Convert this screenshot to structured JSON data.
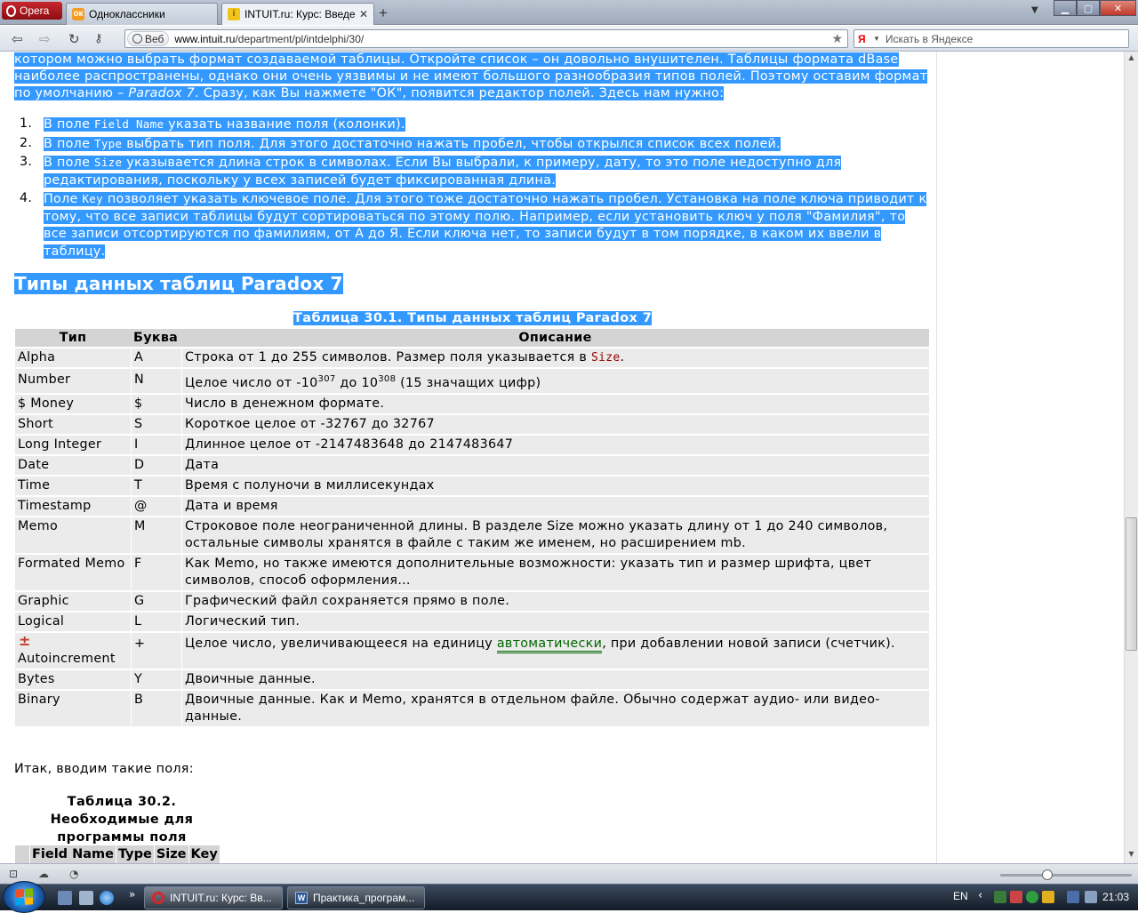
{
  "browser": {
    "menu_label": "Opera",
    "tabs": [
      {
        "title": "Одноклассники",
        "favicon": "odnoklassniki-icon"
      },
      {
        "title": "INTUIT.ru: Курс: Введе...",
        "favicon": "intuit-icon"
      }
    ],
    "address": {
      "badge": "Веб",
      "host": "www.intuit.ru",
      "path": "/department/pl/intdelphi/30/"
    },
    "search_placeholder": "Искать в Яндексе"
  },
  "content": {
    "lead": "котором можно выбрать формат создаваемой таблицы. Откройте список – он довольно внушителен. Таблицы формата dBase наиболее распространены, однако они очень уязвимы и не имеют большого разнообразия типов полей. Поэтому оставим формат по умолчанию – ",
    "lead_em": "Paradox 7",
    "lead_tail": ". Сразу, как Вы нажмете \"ОК\", появится редактор полей. Здесь нам нужно:",
    "steps": [
      {
        "num": "1.",
        "a": "В поле ",
        "code": "Field Name",
        "b": " указать название поля (колонки)."
      },
      {
        "num": "2.",
        "a": "В поле ",
        "code": "Type",
        "b": " выбрать тип поля. Для этого достаточно нажать пробел, чтобы открылся список всех полей."
      },
      {
        "num": "3.",
        "a": "В поле ",
        "code": "Size",
        "b": " указывается длина строк в символах. Если Вы выбрали, к примеру, дату, то это поле недоступно для редактирования, поскольку у всех записей будет фиксированная длина."
      },
      {
        "num": "4.",
        "a": "Поле ",
        "code": "Key",
        "b": " позволяет указать ключевое поле. Для этого тоже достаточно нажать пробел. Установка на поле ключа приводит к тому, что все записи таблицы будут сортироваться по этому полю. Например, если установить ключ у поля \"Фамилия\", то все записи отсортируются по фамилиям, от А до Я. Если ключа нет, то записи будут в том порядке, в каком их ввели в таблицу."
      }
    ],
    "section_title": "Типы данных таблиц Paradox 7",
    "table_caption": "Таблица 30.1. Типы данных таблиц Paradox 7",
    "table_headers": [
      "Тип",
      "Буква",
      "Описание"
    ],
    "rows": [
      {
        "type": "Alpha",
        "letter": "A",
        "desc": "Строка от 1 до 255 символов. Размер поля указывается в ",
        "desc_code": "Size",
        "desc_tail": "."
      },
      {
        "type": "Number",
        "letter": "N",
        "desc_pre": "Целое число от -10",
        "sup1": "307",
        "desc_mid": " до 10",
        "sup2": "308",
        "desc_post": " (15 значащих цифр)"
      },
      {
        "type": "$ Money",
        "letter": "$",
        "desc": "Число в денежном формате."
      },
      {
        "type": "Short",
        "letter": "S",
        "desc": "Короткое целое от -32767 до 32767"
      },
      {
        "type": "Long Integer",
        "letter": "I",
        "desc": "Длинное целое от -2147483648 до 2147483647"
      },
      {
        "type": "Date",
        "letter": "D",
        "desc": "Дата"
      },
      {
        "type": "Time",
        "letter": "T",
        "desc": "Время с полуночи в миллисекундах"
      },
      {
        "type": "Timestamp",
        "letter": "@",
        "desc": "Дата и время"
      },
      {
        "type": "Memo",
        "letter": "M",
        "desc": "Строковое поле неограниченной длины. В разделе Size можно указать длину от 1 до 240 символов, остальные символы хранятся в файле с таким же именем, но расширением mb."
      },
      {
        "type": "Formated Memo",
        "letter": "F",
        "desc": "Как Memo, но также имеются дополнительные возможности: указать тип и размер шрифта, цвет символов, способ оформления…"
      },
      {
        "type": "Graphic",
        "letter": "G",
        "desc": "Графический файл сохраняется прямо в поле."
      },
      {
        "type": "Logical",
        "letter": "L",
        "desc": "Логический тип."
      },
      {
        "type": "Autoincrement",
        "letter": "+",
        "desc": "Целое число, увеличивающееся на единицу ",
        "desc_link": "автоматически",
        "desc_tail": ", при добавлении новой записи (счетчик)."
      },
      {
        "type": "Bytes",
        "letter": "Y",
        "desc": "Двоичные данные."
      },
      {
        "type": "Binary",
        "letter": "B",
        "desc": "Двоичные данные. Как и Memo, хранятся в отдельном файле. Обычно содержат аудио- или видео-данные."
      }
    ],
    "after_table": "Итак, вводим такие поля:",
    "table2_caption": "Таблица 30.2. Необходимые для программы поля",
    "table2_headers": [
      "Field Name",
      "Type",
      "Size",
      "Key"
    ]
  },
  "taskbar": {
    "items": [
      {
        "title": "INTUIT.ru: Курс: Вв..."
      },
      {
        "title": "Практика_програм..."
      }
    ],
    "lang": "EN",
    "clock": "21:03"
  },
  "colors": {
    "selection": "#3399ff",
    "link": "#006600",
    "code_red": "#990000",
    "header_bg": "#d4d4d4",
    "row_bg": "#ebebeb"
  }
}
